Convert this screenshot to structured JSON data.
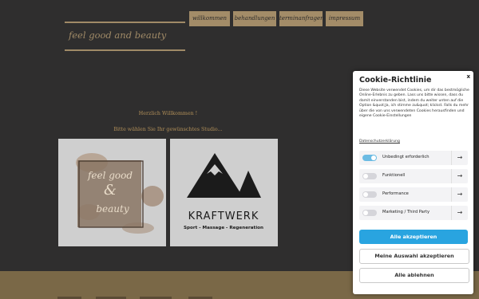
{
  "brand": {
    "logo_text": "feel good and beauty"
  },
  "nav": [
    {
      "label": "willkommen"
    },
    {
      "label": "behandlungen"
    },
    {
      "label": "terminanfragen"
    },
    {
      "label": "impressum"
    }
  ],
  "main": {
    "welcome": "Herzlich Willkommen !",
    "choose": "Bitte wählen Sie Ihr gewünschtes Studio...",
    "studios": [
      {
        "logo_text_1": "feel good",
        "logo_text_2": "&",
        "logo_text_3": "beauty"
      },
      {
        "logo_text": "KRAFTWERK",
        "tagline": "Sport - Massage - Regeneration"
      }
    ]
  },
  "cookie": {
    "close": "x",
    "title": "Cookie-Richtlinie",
    "description": "Diese Website verwendet Cookies, um dir das bestmögliche Online-Erlebnis zu geben. Lass uns bitte wissen, dass du damit einverstanden bist, indem du weiter unten auf die Option &quot;Ja, ich stimme zu&quot; klickst. Falls du mehr über die von uns verwendeten Cookies herausfinden und eigene Cookie-Einstellungen",
    "privacy_link": "Datenschutzerklärung",
    "categories": [
      {
        "label": "Unbedingt erforderlich",
        "enabled": true
      },
      {
        "label": "Funktionell",
        "enabled": false
      },
      {
        "label": "Performance",
        "enabled": false
      },
      {
        "label": "Marketing / Third Party",
        "enabled": false
      }
    ],
    "buttons": {
      "accept_all": "Alle akzeptieren",
      "accept_selection": "Meine Auswahl akzeptieren",
      "reject_all": "Alle ablehnen"
    }
  },
  "colors": {
    "background": "#2f2e2e",
    "accent": "#a38c68",
    "primary_button": "#29a4e0",
    "footer": "#7a6847"
  }
}
